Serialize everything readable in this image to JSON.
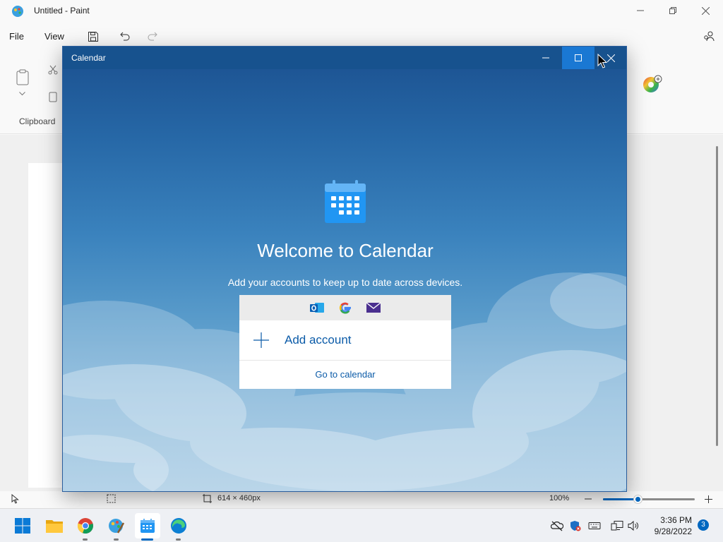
{
  "paint": {
    "title": "Untitled - Paint",
    "menu": {
      "file": "File",
      "view": "View"
    },
    "ribbon": {
      "clipboard_label": "Clipboard"
    },
    "status": {
      "canvas_size": "614 × 460px",
      "zoom": "100%",
      "zoom_fraction": 0.38
    }
  },
  "calendar": {
    "window_title": "Calendar",
    "welcome": "Welcome to Calendar",
    "subtitle": "Add your accounts to keep up to date across devices.",
    "providers": [
      "outlook-icon",
      "google-icon",
      "mail-icon"
    ],
    "add_account": "Add account",
    "go_to_calendar": "Go to calendar"
  },
  "taskbar": {
    "apps": [
      "windows-start-icon",
      "file-explorer-icon",
      "chrome-icon",
      "paint-icon",
      "calendar-icon",
      "edge-icon"
    ],
    "active_app": "calendar-icon",
    "time": "3:36 PM",
    "date": "9/28/2022",
    "notifications": "3"
  },
  "colors": {
    "accent": "#0067c0",
    "calendar_titlebar": "#17528e",
    "link": "#0b5ba8"
  }
}
